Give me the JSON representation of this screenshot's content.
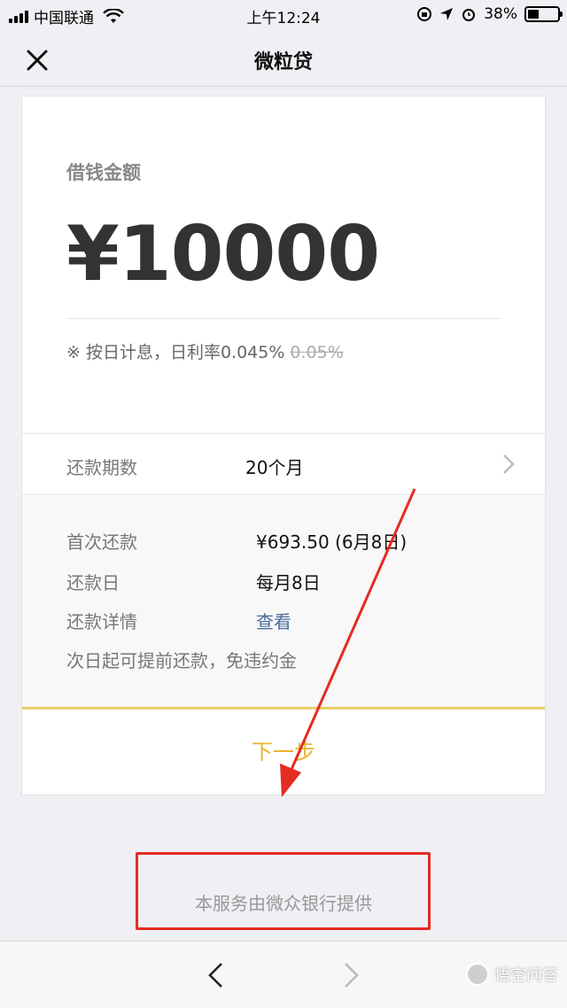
{
  "status_bar": {
    "carrier": "中国联通",
    "time": "上午12:24",
    "battery": "38%",
    "battery_level": 0.38
  },
  "nav": {
    "title": "微粒贷",
    "close_icon": "close-icon"
  },
  "loan": {
    "amount_label": "借钱金额",
    "amount": "¥10000",
    "rate_note": "※ 按日计息，日利率0.045%",
    "old_rate": "0.05%"
  },
  "period": {
    "label": "还款期数",
    "value": "20个月",
    "icon": "chevron-right-icon"
  },
  "details": {
    "first_label": "首次还款",
    "first_value": "¥693.50 (6月8日)",
    "day_label": "还款日",
    "day_value": "每月8日",
    "detail_label": "还款详情",
    "detail_link": "查看",
    "note": "次日起可提前还款，免违约金"
  },
  "next_button": "下一步",
  "provider": "本服务由微众银行提供",
  "bottom_bar": {
    "back_icon": "chevron-left-icon",
    "forward_icon": "chevron-right-icon",
    "watermark": "悟空问答"
  },
  "colors": {
    "accent_gold": "#e8b42c",
    "link_blue": "#4a6b9c",
    "annotation_red": "#e52b22"
  }
}
